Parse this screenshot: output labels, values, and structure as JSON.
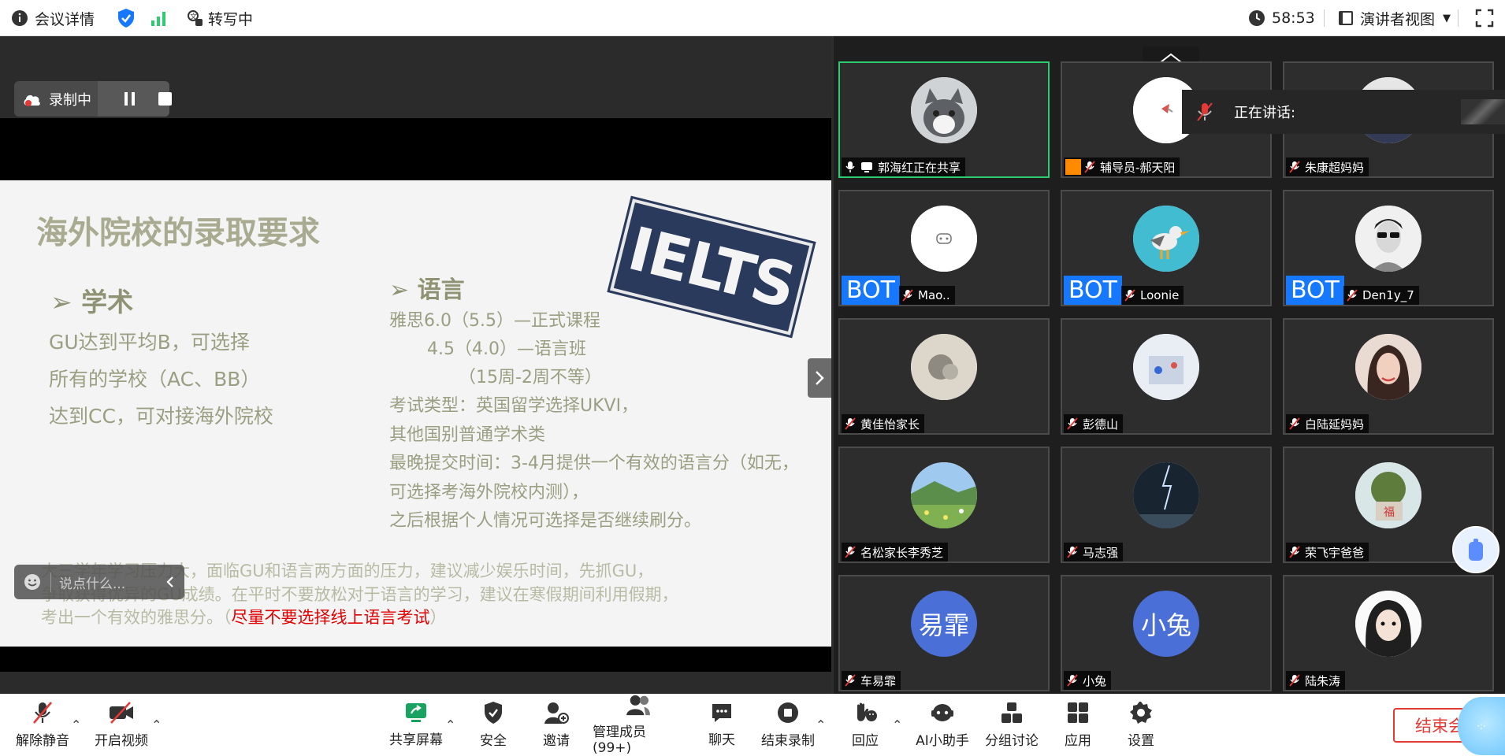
{
  "topbar": {
    "meeting_info": "会议详情",
    "transcribe": "转写中",
    "timer": "58:53",
    "view_mode": "演讲者视图"
  },
  "recording": {
    "label": "录制中"
  },
  "slide": {
    "title": "海外院校的录取要求",
    "academic": {
      "heading": "学术",
      "lines": [
        "GU达到平均B，可选择",
        "所有的学校（AC、BB）",
        "达到CC，可对接海外院校"
      ]
    },
    "language": {
      "heading": "语言",
      "lines": [
        "雅思6.0（5.5）—正式课程",
        "4.5（4.0）—语言班",
        "（15周-2周不等）",
        "考试类型：英国留学选择UKVI，",
        "其他国别普通学术类",
        "最晚提交时间：3-4月提供一个有效的语言分（如无，",
        "可选择考海外院校内测），",
        "之后根据个人情况可选择是否继续刷分。"
      ]
    },
    "stamp": "IELTS",
    "footer": [
      "大三学年学习压力大，面临GU和语言两方面的压力，建议减少娱乐时间，先抓GU，",
      "争取获得优异的GU成绩。在平时不要放松对于语言的学习，建议在寒假期间利用假期，",
      "考出一个有效的雅思分。（"
    ],
    "footer_red": "尽量不要选择线上语言考试",
    "footer_end": "）"
  },
  "chat": {
    "placeholder": "说点什么..."
  },
  "speaking": {
    "label": "正在讲话:"
  },
  "participants": [
    {
      "name": "郭海红正在共享",
      "bot": false,
      "avatar": "cat"
    },
    {
      "name": "辅导员-郝天阳",
      "bot": false,
      "avatar": "bird"
    },
    {
      "name": "朱康超妈妈",
      "bot": false,
      "avatar": "photo"
    },
    {
      "name": "Mao..",
      "bot": true,
      "avatar": "robot"
    },
    {
      "name": "Loonie",
      "bot": true,
      "avatar": "seagull"
    },
    {
      "name": "Den1y_7",
      "bot": true,
      "avatar": "man"
    },
    {
      "name": "黄佳怡家长",
      "bot": false,
      "avatar": "flowers"
    },
    {
      "name": "彭德山",
      "bot": false,
      "avatar": "room"
    },
    {
      "name": "白陆延妈妈",
      "bot": false,
      "avatar": "woman"
    },
    {
      "name": "名松家长李秀芝",
      "bot": false,
      "avatar": "field"
    },
    {
      "name": "马志强",
      "bot": false,
      "avatar": "lightning"
    },
    {
      "name": "荣飞宇爸爸",
      "bot": false,
      "avatar": "tree"
    },
    {
      "name": "车易霏",
      "bot": false,
      "avatar": "text",
      "avatar_text": "易霏"
    },
    {
      "name": "小兔",
      "bot": false,
      "avatar": "text",
      "avatar_text": "小兔"
    },
    {
      "name": "陆朱涛",
      "bot": false,
      "avatar": "girl"
    }
  ],
  "bot_label": "BOT",
  "toolbar": {
    "unmute": "解除静音",
    "video": "开启视频",
    "share": "共享屏幕",
    "security": "安全",
    "invite": "邀请",
    "members": "管理成员(99+)",
    "chat": "聊天",
    "end_record": "结束录制",
    "react": "回应",
    "ai": "AI小助手",
    "breakout": "分组讨论",
    "apps": "应用",
    "settings": "设置",
    "end_meeting": "结束会"
  },
  "colors": {
    "accent": "#1677ff",
    "active_border": "#2ecc71",
    "danger": "#e53935",
    "slide_text": "#9b9f82"
  }
}
